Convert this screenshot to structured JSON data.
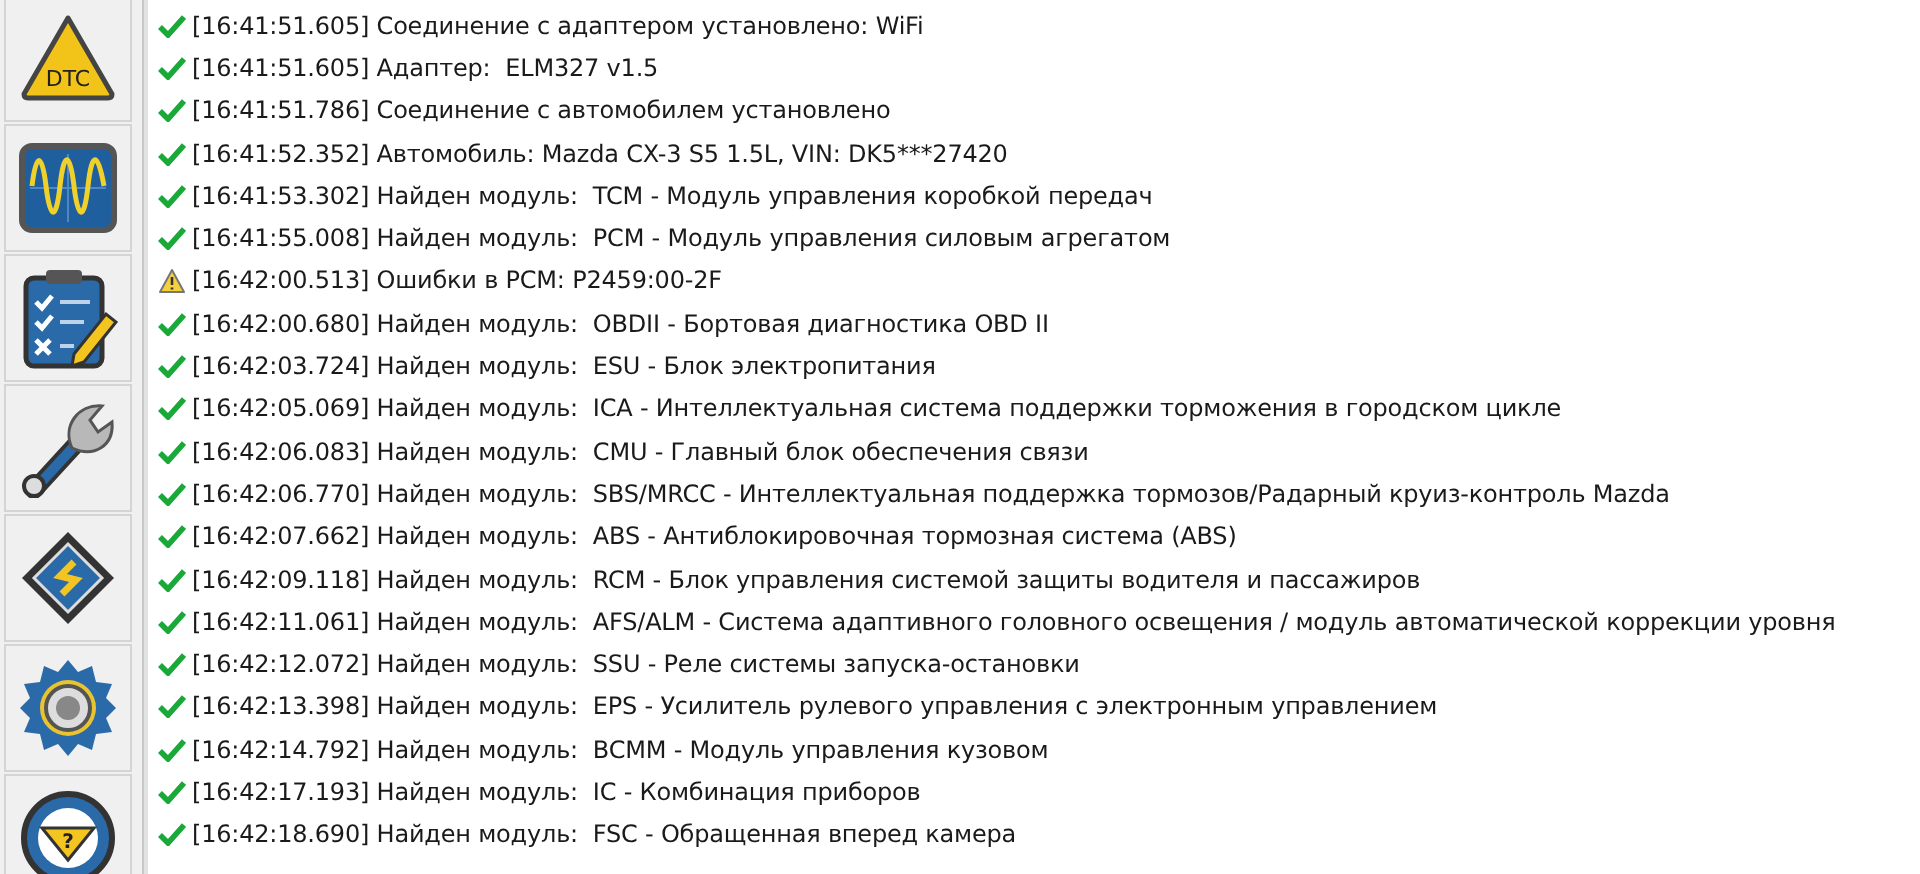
{
  "sidebar": {
    "buttons": [
      {
        "kind": "dtc",
        "label": "DTC"
      },
      {
        "kind": "oscilloscope"
      },
      {
        "kind": "checklist"
      },
      {
        "kind": "wrench"
      },
      {
        "kind": "chip"
      },
      {
        "kind": "gear"
      },
      {
        "kind": "help",
        "label": "?"
      }
    ]
  },
  "log": [
    {
      "kind": "ok",
      "text": "[16:41:51.605] Соединение с адаптером установлено: WiFi"
    },
    {
      "kind": "ok",
      "text": "[16:41:51.605] Адаптер:  ELM327 v1.5"
    },
    {
      "kind": "ok",
      "text": "[16:41:51.786] Соединение с автомобилем установлено"
    },
    {
      "kind": "ok",
      "text": "[16:41:52.352] Автомобиль: Mazda CX-3 S5 1.5L, VIN: DK5***27420"
    },
    {
      "kind": "ok",
      "text": "[16:41:53.302] Найден модуль:  TCM - Модуль управления коробкой передач"
    },
    {
      "kind": "ok",
      "text": "[16:41:55.008] Найден модуль:  PCM - Модуль управления силовым агрегатом"
    },
    {
      "kind": "warning",
      "text": "[16:42:00.513] Ошибки в PCM: P2459:00-2F"
    },
    {
      "kind": "ok",
      "text": "[16:42:00.680] Найден модуль:  OBDII - Бортовая диагностика OBD II"
    },
    {
      "kind": "ok",
      "text": "[16:42:03.724] Найден модуль:  ESU - Блок электропитания"
    },
    {
      "kind": "ok",
      "text": "[16:42:05.069] Найден модуль:  ICA - Интеллектуальная система поддержки торможения в городском цикле"
    },
    {
      "kind": "ok",
      "text": "[16:42:06.083] Найден модуль:  CMU - Главный блок обеспечения связи"
    },
    {
      "kind": "ok",
      "text": "[16:42:06.770] Найден модуль:  SBS/MRCC - Интеллектуальная поддержка тормозов/Радарный круиз-контроль Mazda"
    },
    {
      "kind": "ok",
      "text": "[16:42:07.662] Найден модуль:  ABS - Антиблокировочная тормозная система (ABS)"
    },
    {
      "kind": "ok",
      "text": "[16:42:09.118] Найден модуль:  RCM - Блок управления системой защиты водителя и пассажиров"
    },
    {
      "kind": "ok",
      "text": "[16:42:11.061] Найден модуль:  AFS/ALM - Система адаптивного головного освещения / модуль автоматической коррекции уровня"
    },
    {
      "kind": "ok",
      "text": "[16:42:12.072] Найден модуль:  SSU - Реле системы запуска-остановки"
    },
    {
      "kind": "ok",
      "text": "[16:42:13.398] Найден модуль:  EPS - Усилитель рулевого управления с электронным управлением"
    },
    {
      "kind": "ok",
      "text": "[16:42:14.792] Найден модуль:  BCMM - Модуль управления кузовом"
    },
    {
      "kind": "ok",
      "text": "[16:42:17.193] Найден модуль:  IC - Комбинация приборов"
    },
    {
      "kind": "ok",
      "text": "[16:42:18.690] Найден модуль:  FSC - Обращенная вперед камера"
    }
  ]
}
